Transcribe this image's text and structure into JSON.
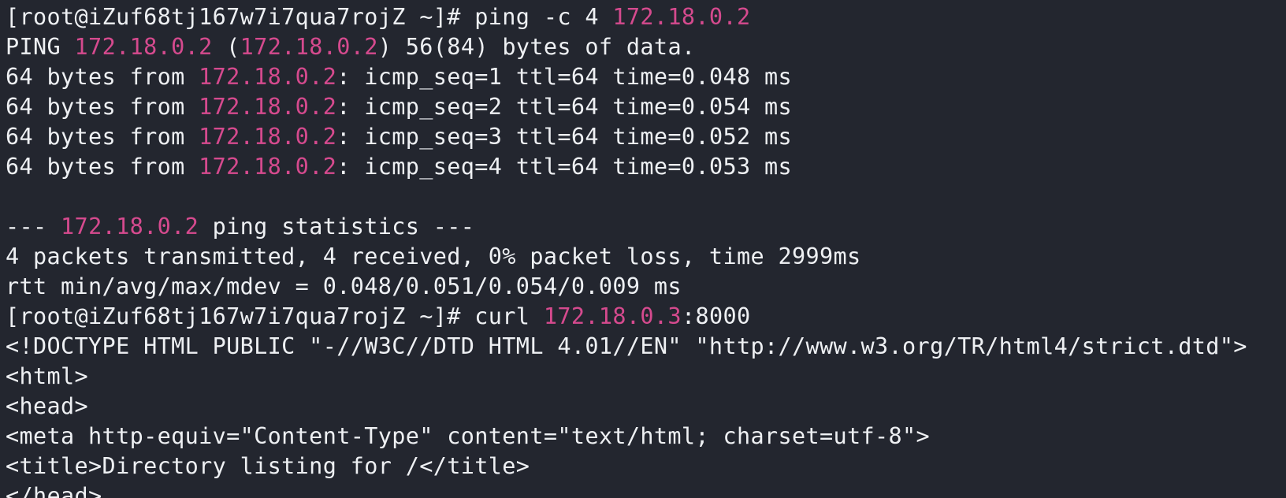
{
  "terminal": {
    "colors": {
      "background": "#23262f",
      "text": "#eef0f3",
      "highlight": "#d54a8e"
    },
    "lines": [
      [
        {
          "t": "[root@iZuf68tj167w7i7qua7rojZ ~]# ping -c 4 "
        },
        {
          "t": "172.18.0.2",
          "h": true
        }
      ],
      [
        {
          "t": "PING "
        },
        {
          "t": "172.18.0.2",
          "h": true
        },
        {
          "t": " ("
        },
        {
          "t": "172.18.0.2",
          "h": true
        },
        {
          "t": ") 56(84) bytes of data."
        }
      ],
      [
        {
          "t": "64 bytes from "
        },
        {
          "t": "172.18.0.2",
          "h": true
        },
        {
          "t": ": icmp_seq=1 ttl=64 time=0.048 ms"
        }
      ],
      [
        {
          "t": "64 bytes from "
        },
        {
          "t": "172.18.0.2",
          "h": true
        },
        {
          "t": ": icmp_seq=2 ttl=64 time=0.054 ms"
        }
      ],
      [
        {
          "t": "64 bytes from "
        },
        {
          "t": "172.18.0.2",
          "h": true
        },
        {
          "t": ": icmp_seq=3 ttl=64 time=0.052 ms"
        }
      ],
      [
        {
          "t": "64 bytes from "
        },
        {
          "t": "172.18.0.2",
          "h": true
        },
        {
          "t": ": icmp_seq=4 ttl=64 time=0.053 ms"
        }
      ],
      [
        {
          "t": ""
        }
      ],
      [
        {
          "t": "--- "
        },
        {
          "t": "172.18.0.2",
          "h": true
        },
        {
          "t": " ping statistics ---"
        }
      ],
      [
        {
          "t": "4 packets transmitted, 4 received, 0% packet loss, time 2999ms"
        }
      ],
      [
        {
          "t": "rtt min/avg/max/mdev = 0.048/0.051/0.054/0.009 ms"
        }
      ],
      [
        {
          "t": "[root@iZuf68tj167w7i7qua7rojZ ~]# curl "
        },
        {
          "t": "172.18.0.3",
          "h": true
        },
        {
          "t": ":8000"
        }
      ],
      [
        {
          "t": "<!DOCTYPE HTML PUBLIC \"-//W3C//DTD HTML 4.01//EN\" \"http://www.w3.org/TR/html4/strict.dtd\">"
        }
      ],
      [
        {
          "t": "<html>"
        }
      ],
      [
        {
          "t": "<head>"
        }
      ],
      [
        {
          "t": "<meta http-equiv=\"Content-Type\" content=\"text/html; charset=utf-8\">"
        }
      ],
      [
        {
          "t": "<title>Directory listing for /</title>"
        }
      ],
      [
        {
          "t": "</head>"
        }
      ]
    ]
  }
}
